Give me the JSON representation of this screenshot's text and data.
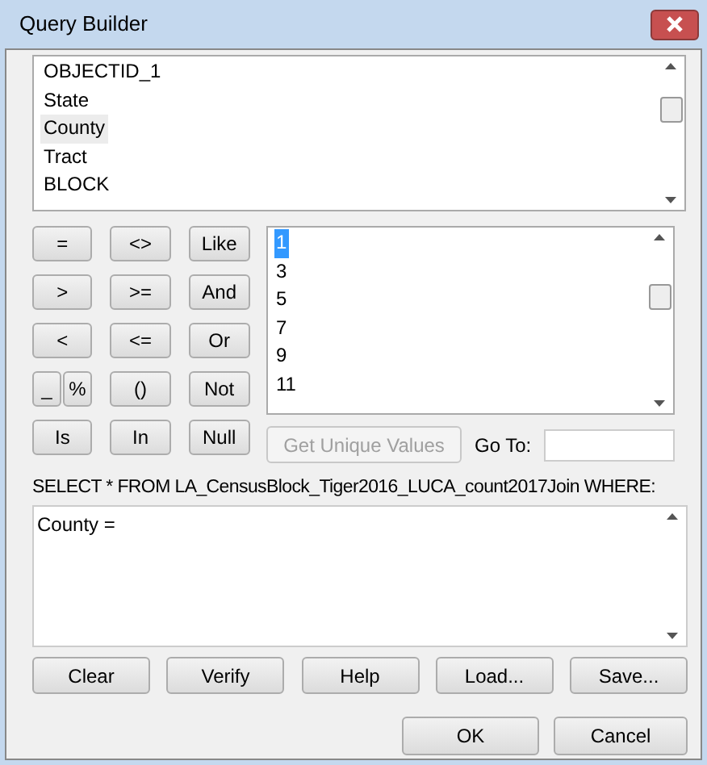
{
  "window": {
    "title": "Query Builder"
  },
  "fields": [
    {
      "label": "OBJECTID_1",
      "selected": false
    },
    {
      "label": "State",
      "selected": false
    },
    {
      "label": "County",
      "selected": true
    },
    {
      "label": "Tract",
      "selected": false
    },
    {
      "label": "BLOCK",
      "selected": false
    }
  ],
  "operators": [
    [
      "=",
      "<>",
      "Like"
    ],
    [
      ">",
      ">=",
      "And"
    ],
    [
      "<",
      "<=",
      "Or"
    ],
    [
      "_",
      "%",
      "()",
      "Not"
    ],
    [
      "Is",
      "In",
      "Null"
    ]
  ],
  "values": [
    {
      "label": "1",
      "selected": true
    },
    {
      "label": "3",
      "selected": false
    },
    {
      "label": "5",
      "selected": false
    },
    {
      "label": "7",
      "selected": false
    },
    {
      "label": "9",
      "selected": false
    },
    {
      "label": "11",
      "selected": false
    }
  ],
  "get_unique_values": {
    "label": "Get Unique Values",
    "disabled": true
  },
  "goto": {
    "label": "Go To:"
  },
  "query_label": "SELECT * FROM LA_CensusBlock_Tiger2016_LUCA_count2017Join WHERE:",
  "query": "County =",
  "actions": [
    "Clear",
    "Verify",
    "Help",
    "Load...",
    "Save..."
  ],
  "dialog_buttons": [
    "OK",
    "Cancel"
  ]
}
